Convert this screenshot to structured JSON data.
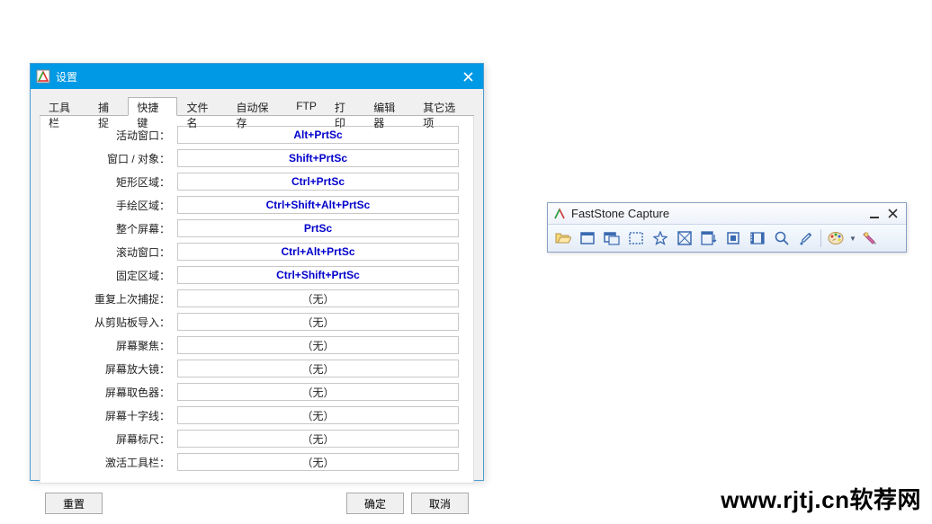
{
  "settings": {
    "title": "设置",
    "tabs": [
      "工具栏",
      "捕捉",
      "快捷键",
      "文件名",
      "自动保存",
      "FTP",
      "打印",
      "编辑器",
      "其它选项"
    ],
    "active_tab_index": 2,
    "hotkeys": [
      {
        "label": "活动窗口：",
        "value": "Alt+PrtSc",
        "assigned": true
      },
      {
        "label": "窗口 / 对象：",
        "value": "Shift+PrtSc",
        "assigned": true
      },
      {
        "label": "矩形区域：",
        "value": "Ctrl+PrtSc",
        "assigned": true
      },
      {
        "label": "手绘区域：",
        "value": "Ctrl+Shift+Alt+PrtSc",
        "assigned": true
      },
      {
        "label": "整个屏幕：",
        "value": "PrtSc",
        "assigned": true
      },
      {
        "label": "滚动窗口：",
        "value": "Ctrl+Alt+PrtSc",
        "assigned": true
      },
      {
        "label": "固定区域：",
        "value": "Ctrl+Shift+PrtSc",
        "assigned": true
      },
      {
        "label": "重复上次捕捉：",
        "value": "（无）",
        "assigned": false
      },
      {
        "label": "从剪贴板导入：",
        "value": "（无）",
        "assigned": false
      },
      {
        "label": "屏幕聚焦：",
        "value": "（无）",
        "assigned": false
      },
      {
        "label": "屏幕放大镜：",
        "value": "（无）",
        "assigned": false
      },
      {
        "label": "屏幕取色器：",
        "value": "（无）",
        "assigned": false
      },
      {
        "label": "屏幕十字线：",
        "value": "（无）",
        "assigned": false
      },
      {
        "label": "屏幕标尺：",
        "value": "（无）",
        "assigned": false
      },
      {
        "label": "激活工具栏：",
        "value": "（无）",
        "assigned": false
      }
    ],
    "buttons": {
      "reset": "重置",
      "ok": "确定",
      "cancel": "取消"
    }
  },
  "toolbar": {
    "title": "FastStone Capture",
    "buttons": [
      {
        "name": "open-file-icon",
        "title": "Open"
      },
      {
        "name": "capture-window-icon",
        "title": "Active Window"
      },
      {
        "name": "capture-object-icon",
        "title": "Window/Object"
      },
      {
        "name": "capture-rect-icon",
        "title": "Rectangle"
      },
      {
        "name": "capture-freehand-icon",
        "title": "Freehand"
      },
      {
        "name": "capture-full-icon",
        "title": "Full Screen"
      },
      {
        "name": "capture-scroll-icon",
        "title": "Scrolling"
      },
      {
        "name": "capture-fixed-icon",
        "title": "Fixed Region"
      },
      {
        "name": "record-icon",
        "title": "Record"
      },
      {
        "name": "magnifier-icon",
        "title": "Magnifier"
      },
      {
        "name": "color-picker-icon",
        "title": "Color Picker"
      },
      {
        "name": "sep"
      },
      {
        "name": "palette-icon",
        "title": "Output"
      },
      {
        "name": "dropdown"
      },
      {
        "name": "settings-icon",
        "title": "Settings"
      }
    ]
  },
  "footer": "www.rjtj.cn软荐网"
}
